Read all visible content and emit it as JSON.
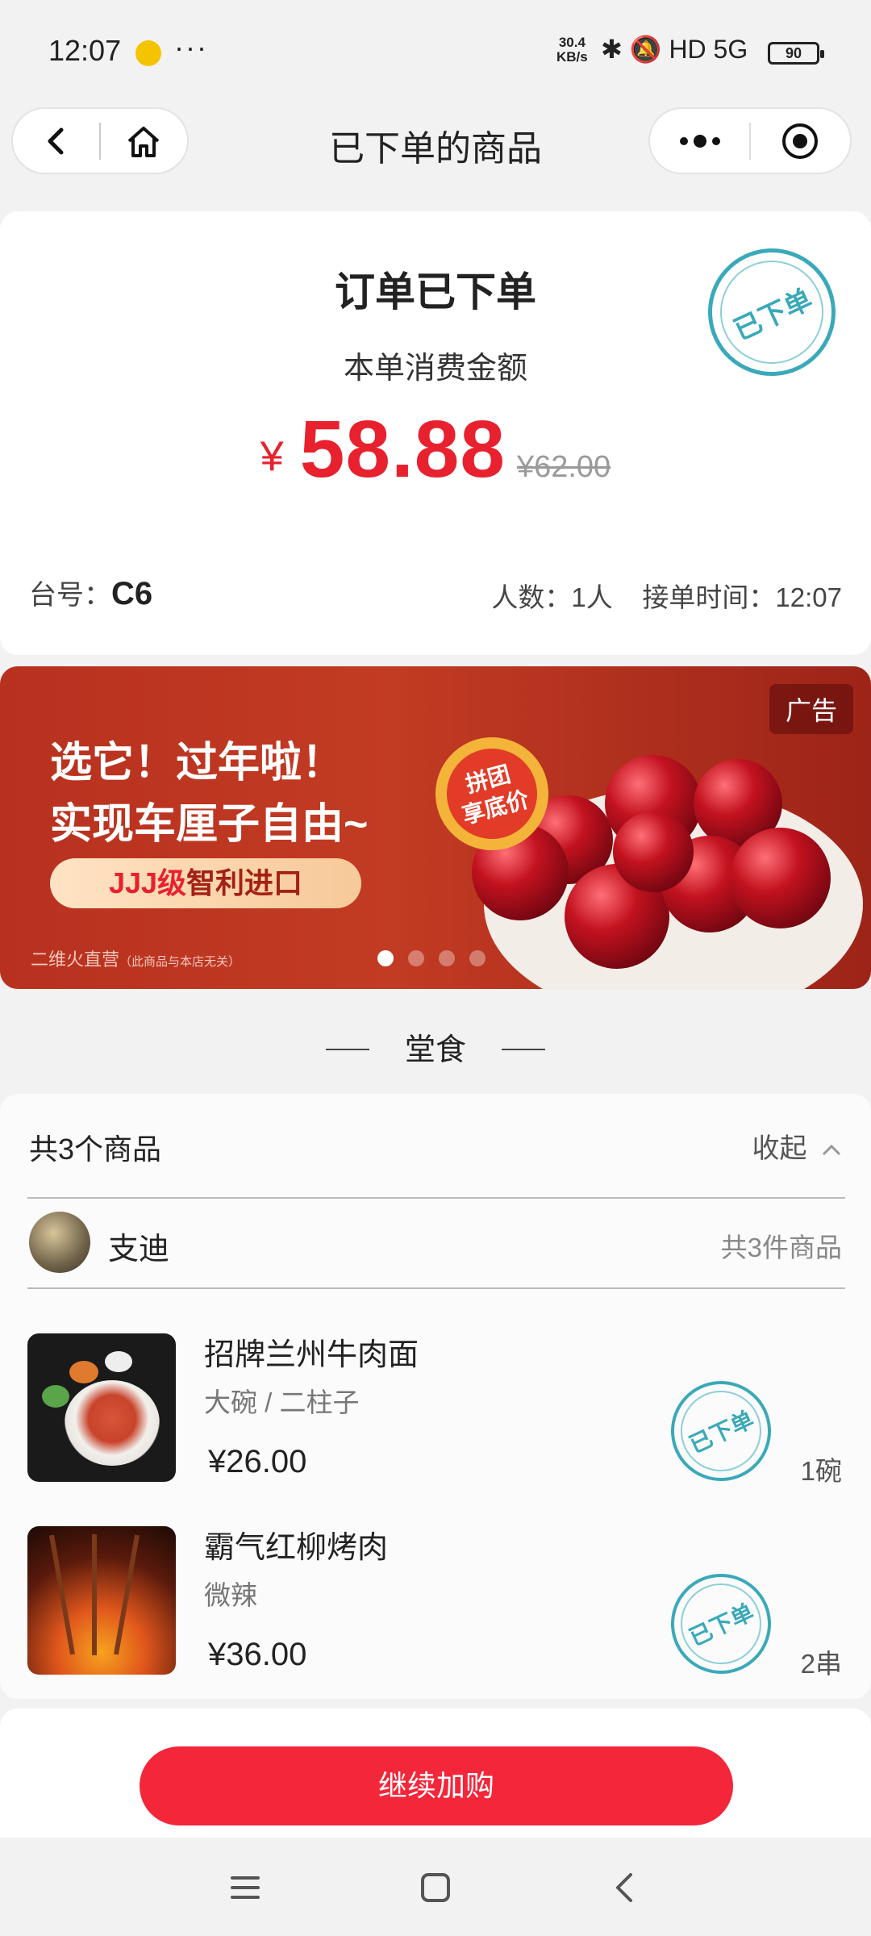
{
  "status_bar": {
    "time": "12:07",
    "more": "···",
    "net_speed_top": "30.4",
    "net_speed_bottom": "KB/s",
    "icons": "✱ 🔕 HD 5G",
    "battery": "90"
  },
  "nav": {
    "title": "已下单的商品",
    "back_icon": "chevron-left-icon",
    "home_icon": "home-icon",
    "more_icon": "more-icon",
    "close_icon": "target-icon"
  },
  "order": {
    "title": "订单已下单",
    "amount_label": "本单消费金额",
    "currency": "¥",
    "amount": "58.88",
    "original_price": "¥62.00",
    "stamp": "已下单",
    "table_label": "台号：",
    "table_no": "C6",
    "people": "人数：1人",
    "order_time": "接单时间：12:07"
  },
  "ad": {
    "tag": "广告",
    "line1": "选它！过年啦！",
    "line2": "实现车厘子自由~",
    "button_prefix": "JJJ级",
    "button_text": "智利进口",
    "badge_line1": "拼团",
    "badge_line2": "享底价",
    "footer": "二维火直营",
    "footer_note": "（此商品与本店无关）",
    "carousel_count": 4,
    "carousel_active": 1
  },
  "section": {
    "label": "堂食"
  },
  "items_card": {
    "count_label": "共3个商品",
    "collapse_label": "收起",
    "user_name": "支迪",
    "user_count": "共3件商品",
    "items": [
      {
        "name": "招牌兰州牛肉面",
        "spec": "大碗 / 二柱子",
        "price": "¥26.00",
        "qty": "1碗",
        "stamp": "已下单"
      },
      {
        "name": "霸气红柳烤肉",
        "spec": "微辣",
        "price": "¥36.00",
        "qty": "2串",
        "stamp": "已下单"
      }
    ]
  },
  "footer": {
    "continue_label": "继续加购"
  },
  "system_nav": {
    "menu_icon": "menu-icon",
    "home_icon": "square-icon",
    "back_icon": "back-icon"
  }
}
